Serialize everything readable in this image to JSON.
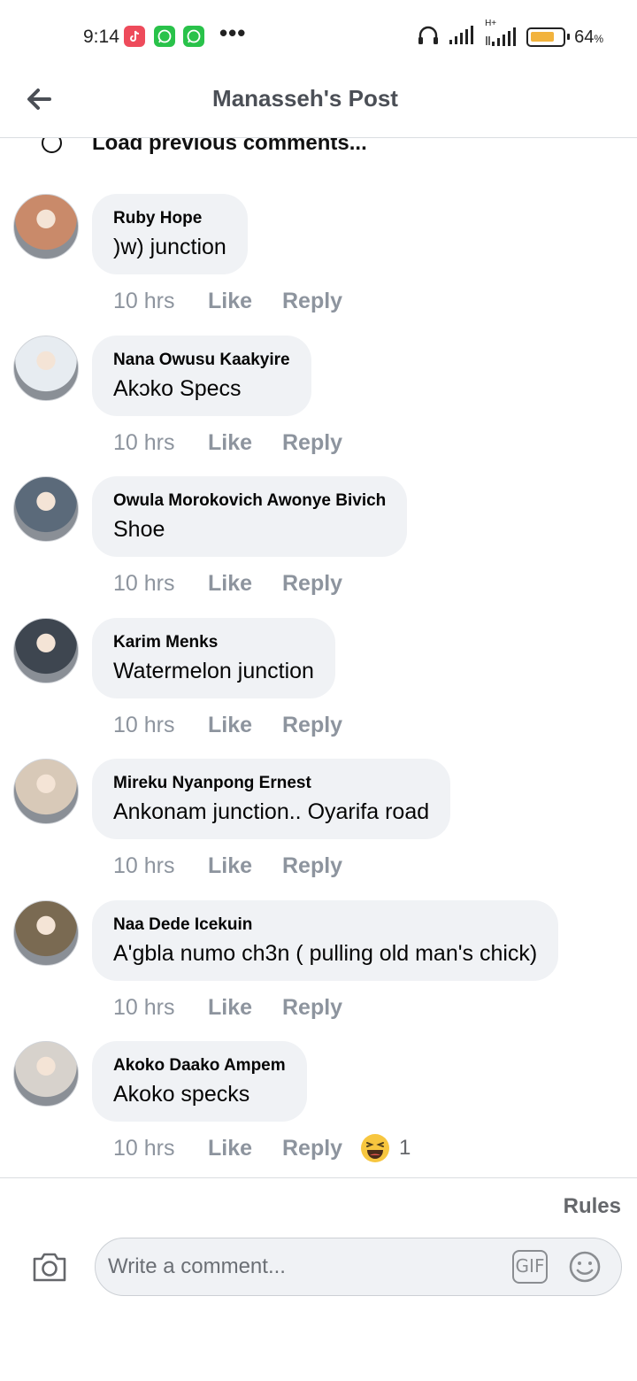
{
  "status_bar": {
    "time": "9:14",
    "more_glyph": "•••",
    "battery_percent": "64",
    "battery_unit": "%",
    "network_label": "H+"
  },
  "header": {
    "title": "Manasseh's Post",
    "back_icon": "arrow-left-icon"
  },
  "load_previous": {
    "label": "Load previous comments..."
  },
  "comments": [
    {
      "author": "Ruby Hope",
      "text": ")w) junction",
      "time": "10 hrs",
      "like": "Like",
      "reply": "Reply",
      "avatar_color": "#c98a6a"
    },
    {
      "author": "Nana Owusu Kaakyire",
      "text": "Akɔko Specs",
      "time": "10 hrs",
      "like": "Like",
      "reply": "Reply",
      "avatar_color": "#e7ecf1"
    },
    {
      "author": "Owula Morokovich Awonye Bivich",
      "text": "Shoe",
      "time": "10 hrs",
      "like": "Like",
      "reply": "Reply",
      "avatar_color": "#5b6a7a"
    },
    {
      "author": "Karim Menks",
      "text": "Watermelon junction",
      "time": "10 hrs",
      "like": "Like",
      "reply": "Reply",
      "avatar_color": "#3e4650"
    },
    {
      "author": "Mireku Nyanpong Ernest",
      "text": "Ankonam junction.. Oyarifa road",
      "time": "10 hrs",
      "like": "Like",
      "reply": "Reply",
      "avatar_color": "#d8c9b8"
    },
    {
      "author": "Naa Dede Icekuin",
      "text": "A'gbla numo ch3n ( pulling old man's chick)",
      "time": "10 hrs",
      "like": "Like",
      "reply": "Reply",
      "avatar_color": "#7a6a52"
    },
    {
      "author": "Akoko Daako Ampem",
      "text": "Akoko specks",
      "time": "10 hrs",
      "like": "Like",
      "reply": "Reply",
      "avatar_color": "#d7d2cc",
      "reaction_icon": "laughing-emoji-icon",
      "reaction_count": "1"
    }
  ],
  "footer": {
    "rules": "Rules",
    "composer_placeholder": "Write a comment...",
    "gif_label": "GIF"
  },
  "colors": {
    "bubble": "#f0f2f5",
    "meta_text": "#8d949e",
    "header_title": "#4b4f56"
  }
}
